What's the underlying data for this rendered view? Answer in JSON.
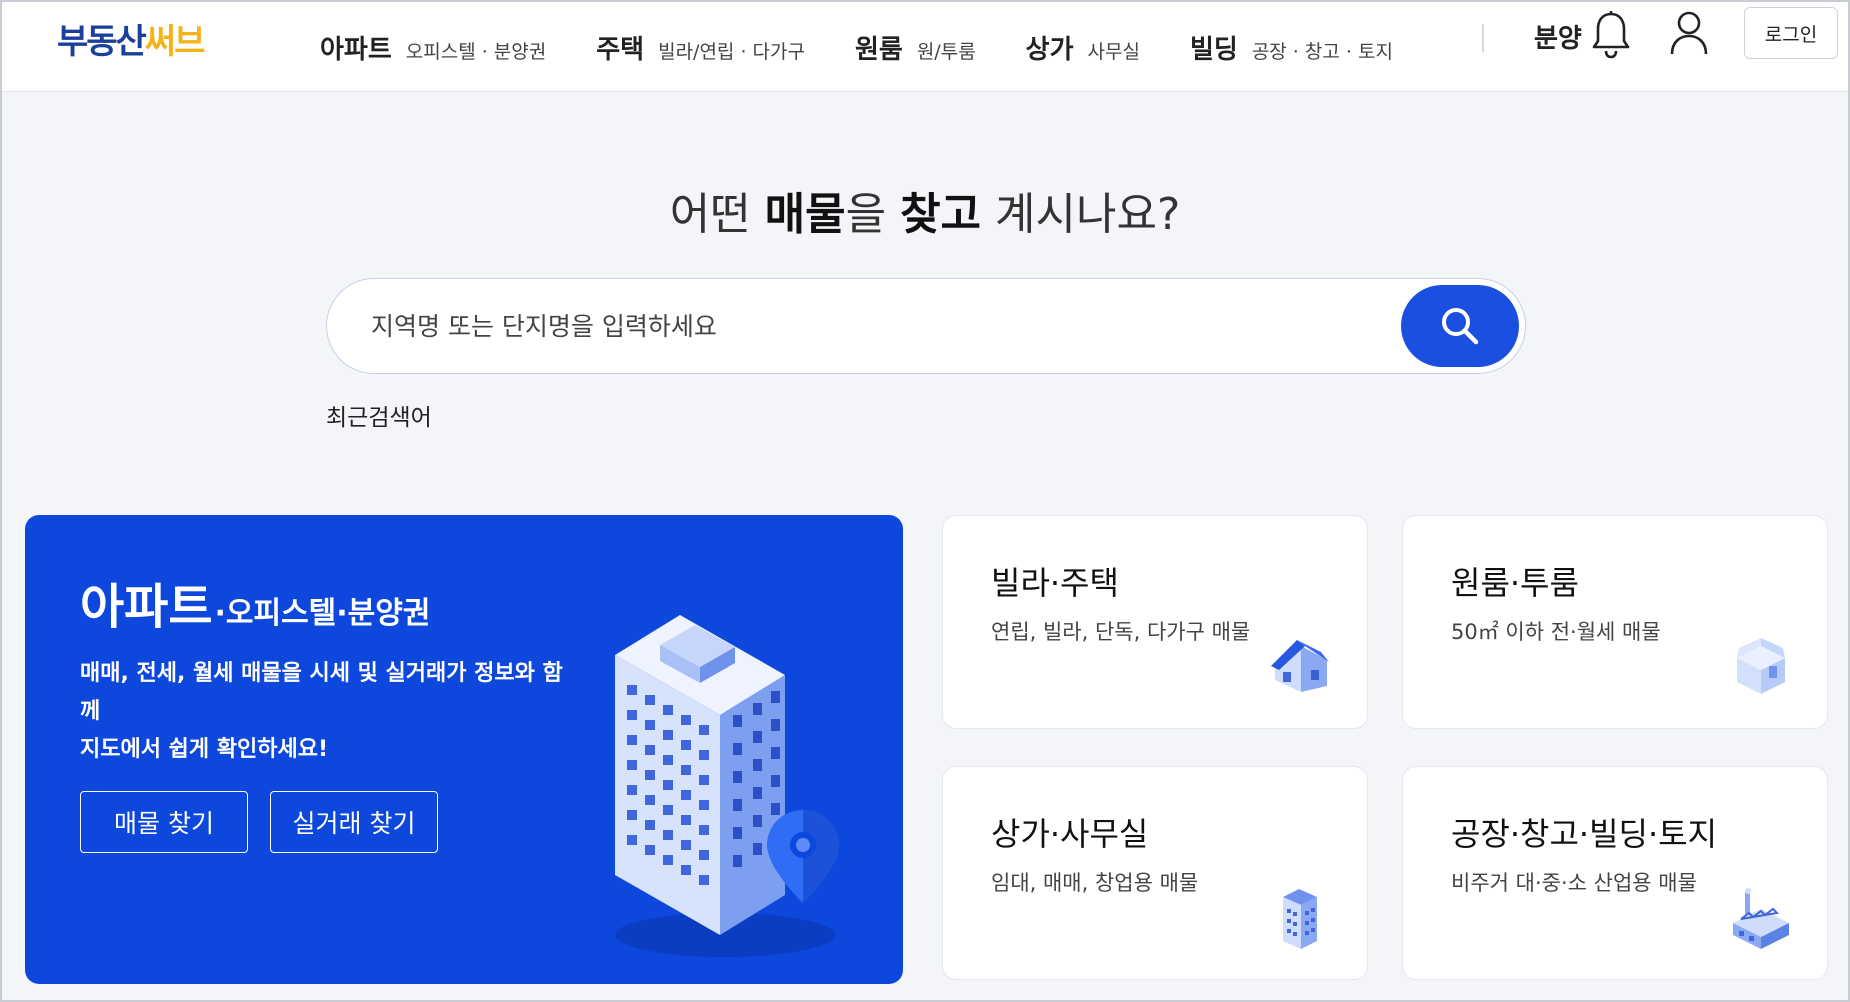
{
  "header": {
    "logo_part1": "부동산",
    "logo_part2": "써브",
    "nav": [
      {
        "main": "아파트",
        "sub": "오피스텔 · 분양권"
      },
      {
        "main": "주택",
        "sub": "빌라/연립 · 다가구"
      },
      {
        "main": "원룸",
        "sub": "원/투룸"
      },
      {
        "main": "상가",
        "sub": "사무실"
      },
      {
        "main": "빌딩",
        "sub": "공장 · 창고 · 토지"
      }
    ],
    "bunyang": "분양",
    "login": "로그인"
  },
  "hero": {
    "title_part1": "어떤 ",
    "title_bold1": "매물",
    "title_part2": "을 ",
    "title_bold2": "찾고",
    "title_part3": " 계시나요?",
    "search_placeholder": "지역명 또는 단지명을 입력하세요",
    "recent_label": "최근검색어"
  },
  "apartment_card": {
    "title_big": "아파트",
    "title_small": "·오피스텔·분양권",
    "desc_line1": "매매, 전세, 월세 매물을 시세 및 실거래가 정보와 함께",
    "desc_line2": "지도에서 쉽게 확인하세요!",
    "button1": "매물 찾기",
    "button2": "실거래 찾기"
  },
  "cards": [
    {
      "title": "빌라·주택",
      "sub": "연립, 빌라, 단독, 다가구 매물",
      "icon": "house-icon"
    },
    {
      "title": "원룸·투룸",
      "sub": "50㎡ 이하 전·월세 매물",
      "icon": "room-icon"
    },
    {
      "title": "상가·사무실",
      "sub": "임대, 매매, 창업용 매물",
      "icon": "office-building-icon"
    },
    {
      "title": "공장·창고·빌딩·토지",
      "sub": "비주거 대·중·소 산업용 매물",
      "icon": "factory-icon"
    }
  ],
  "colors": {
    "brand_navy": "#1d3f9c",
    "brand_yellow": "#f5b31b",
    "accent_blue": "#0d47dc",
    "search_blue": "#1a4fe0"
  }
}
